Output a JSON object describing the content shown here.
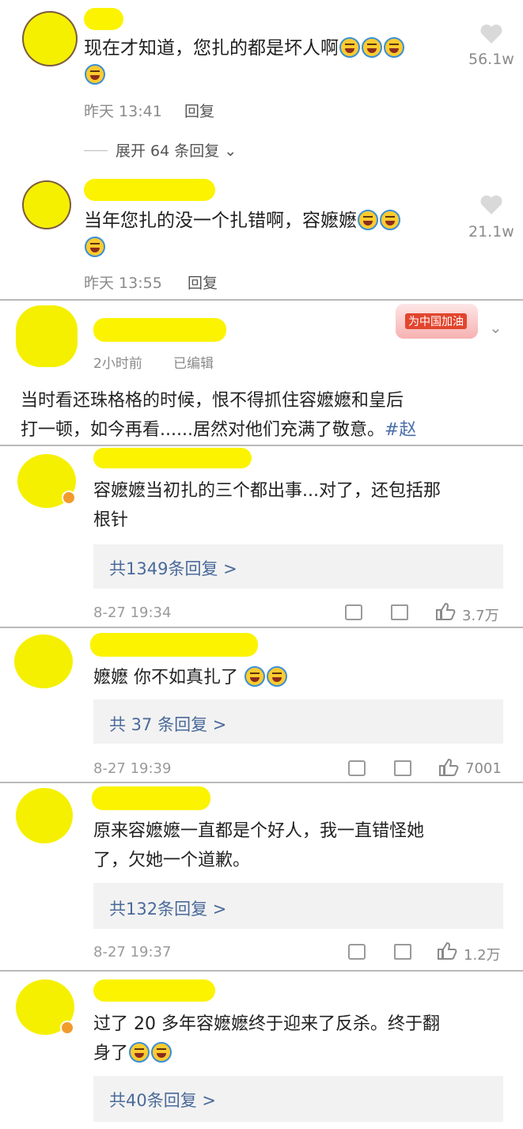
{
  "top_comments": [
    {
      "text": "现在才知道，您扎的都是坏人啊",
      "time": "昨天 13:41",
      "reply": "回复",
      "likes": "56.1w",
      "expand": "展开 64 条回复"
    },
    {
      "text": "当年您扎的没一个扎错啊，容嬷嬷",
      "time": "昨天 13:55",
      "reply": "回复",
      "likes": "21.1w"
    }
  ],
  "weibo_post": {
    "time": "2小时前",
    "edited": "已编辑",
    "badge": "为中国加油",
    "text_line1": "当时看还珠格格的时候，恨不得抓住容嬷嬷和皇后",
    "text_line2": "打一顿，如今再看......居然对他们充满了敬意。",
    "hashtag": "#赵"
  },
  "weibo_comments": [
    {
      "line1": "容嬷嬷当初扎的三个都出事...对了，还包括那",
      "line2": "根针",
      "replies": "共1349条回复 >",
      "time": "8-27 19:34",
      "likes": "3.7万"
    },
    {
      "line1": "嬷嬷 你不如真扎了",
      "line2": "",
      "replies": "共 37 条回复 >",
      "time": "8-27 19:39",
      "likes": "7001"
    },
    {
      "line1": "原来容嬷嬷一直都是个好人，我一直错怪她",
      "line2": "了，欠她一个道歉。",
      "replies": "共132条回复 >",
      "time": "8-27 19:37",
      "likes": "1.2万"
    },
    {
      "line1": "过了 20 多年容嬷嬷终于迎来了反杀。终于翻",
      "line2": "身了",
      "replies": "共40条回复 >"
    }
  ]
}
